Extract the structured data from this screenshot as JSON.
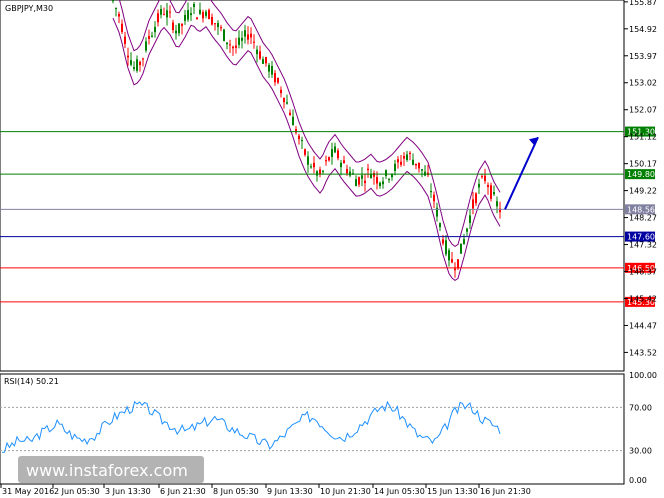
{
  "chart_data": [
    {
      "type": "candlestick",
      "title": "GBPJPY,M30",
      "ylim": [
        142.9,
        155.9
      ],
      "y_ticks": [
        "155.87",
        "154.92",
        "153.97",
        "153.02",
        "152.07",
        "151.12",
        "150.17",
        "149.22",
        "148.27",
        "147.32",
        "146.37",
        "145.42",
        "144.47",
        "143.52"
      ],
      "x_ticks": [
        "31 May 2016",
        "2 Jun 05:30",
        "3 Jun 13:30",
        "6 Jun 21:30",
        "8 Jun 05:30",
        "9 Jun 13:30",
        "10 Jun 21:30",
        "14 Jun 05:30",
        "15 Jun 13:30",
        "16 Jun 21:30"
      ],
      "current_price": "148.56",
      "levels": [
        {
          "label": "151.30",
          "value": 151.3,
          "color": "#008000"
        },
        {
          "label": "149.80",
          "value": 149.8,
          "color": "#008000"
        },
        {
          "label": "148.56",
          "value": 148.56,
          "color": "#8080a0"
        },
        {
          "label": "147.60",
          "value": 147.6,
          "color": "#0000a0"
        },
        {
          "label": "146.50",
          "value": 146.5,
          "color": "#ff0000"
        },
        {
          "label": "145.30",
          "value": 145.3,
          "color": "#ff0000"
        }
      ],
      "forecast_arrow": {
        "from": 148.56,
        "to": 151.1,
        "color": "#0000cc",
        "direction": "up"
      },
      "close_path": [
        155.9,
        155.3,
        154.2,
        153.5,
        153.8,
        154.6,
        155.1,
        155.6,
        155.3,
        154.8,
        155.2,
        155.7,
        155.4,
        155.6,
        155.2,
        154.9,
        154.5,
        154.2,
        154.5,
        154.8,
        154.3,
        153.8,
        153.5,
        153.0,
        152.5,
        151.8,
        151.0,
        150.4,
        150.0,
        149.7,
        150.3,
        150.6,
        150.2,
        149.9,
        149.6,
        149.7,
        149.9,
        149.6,
        149.7,
        149.9,
        150.2,
        150.5,
        150.3,
        150.0,
        149.6,
        148.7,
        147.6,
        146.8,
        146.6,
        147.5,
        148.5,
        149.3,
        149.7,
        149.0,
        148.56
      ],
      "candle_colors": {
        "bull": "#008000",
        "bear": "#ff0000"
      },
      "band_color": "#800080"
    },
    {
      "type": "line",
      "title": "RSI(14) 50.21",
      "ylim": [
        0,
        100
      ],
      "y_ticks": [
        "100.00",
        "70.00",
        "30.00",
        "0.00"
      ],
      "reference_levels": [
        70,
        30
      ],
      "color": "#1e90ff",
      "values": [
        30,
        35,
        40,
        38,
        45,
        50,
        55,
        48,
        42,
        40,
        44,
        52,
        60,
        65,
        70,
        72,
        68,
        60,
        55,
        50,
        48,
        52,
        56,
        60,
        55,
        50,
        46,
        42,
        38,
        35,
        40,
        48,
        55,
        62,
        60,
        52,
        45,
        42,
        48,
        55,
        62,
        70,
        72,
        65,
        55,
        45,
        40,
        38,
        50,
        65,
        72,
        70,
        60,
        55,
        50.21
      ]
    }
  ],
  "watermark": {
    "text": "www.instaforex.com"
  }
}
